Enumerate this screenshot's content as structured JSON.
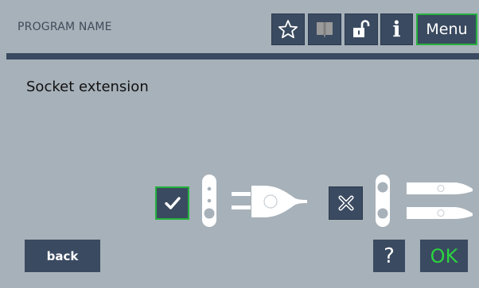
{
  "header": {
    "program_name": "PROGRAM NAME",
    "buttons": {
      "favorite_icon": "star-icon",
      "book_icon": "book-icon",
      "lock_icon": "unlock-icon",
      "info_label": "i",
      "menu_label": "Menu"
    }
  },
  "page": {
    "title": "Socket extension"
  },
  "options": {
    "selected": "with-extension",
    "with_extension": {
      "icon": "check-icon",
      "illustration": "plug-with-socket-extension"
    },
    "without_extension": {
      "icon": "cross-icon",
      "illustration": "plug-without-socket-extension"
    }
  },
  "footer": {
    "back_label": "back",
    "help_label": "?",
    "ok_label": "OK"
  },
  "colors": {
    "background": "#a7b1b9",
    "button": "#3a4a60",
    "accent_green": "#25b040",
    "ok_text": "#2bd43f"
  }
}
